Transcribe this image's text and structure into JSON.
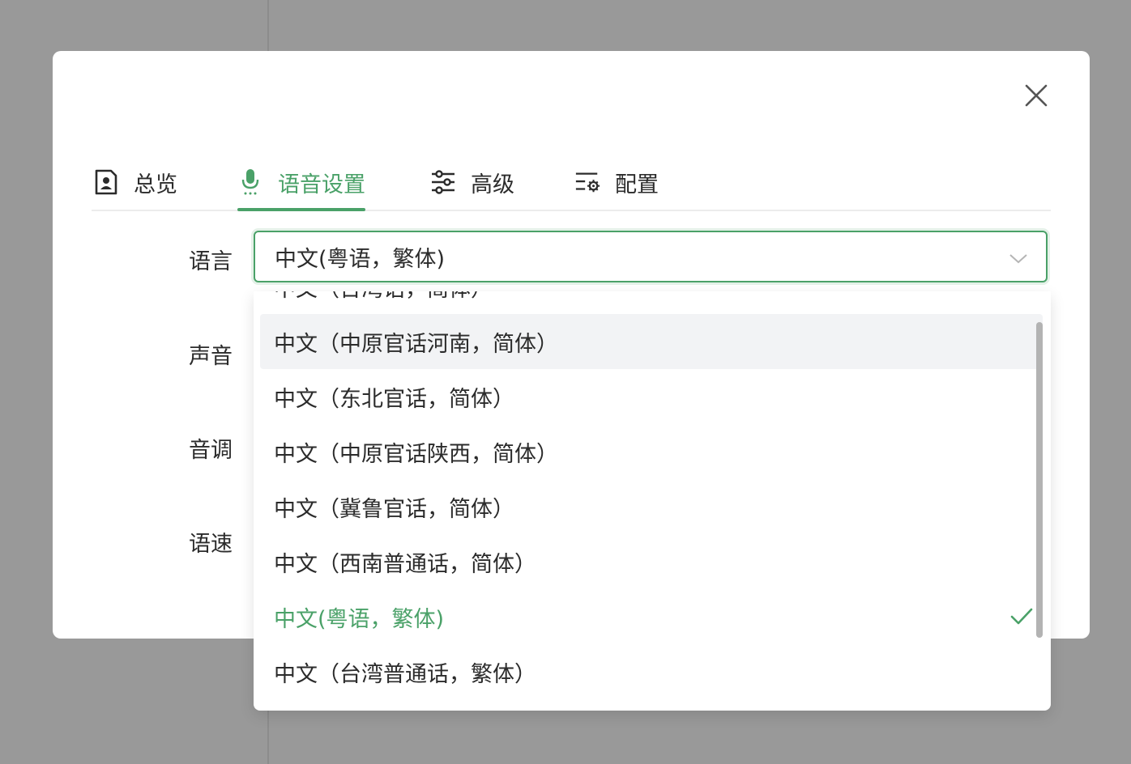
{
  "dialog": {
    "close_icon": "close-icon",
    "tabs": [
      {
        "label": "总览",
        "icon": "document-icon",
        "active": false
      },
      {
        "label": "语音设置",
        "icon": "microphone-icon",
        "active": true
      },
      {
        "label": "高级",
        "icon": "sliders-icon",
        "active": false
      },
      {
        "label": "配置",
        "icon": "list-gear-icon",
        "active": false
      }
    ],
    "form": {
      "language_label": "语言",
      "voice_label": "声音",
      "pitch_label": "音调",
      "speed_label": "语速",
      "language_value": "中文(粤语，繁体)"
    }
  },
  "dropdown": {
    "options": [
      "中文（台湾话，简体）",
      "中文（中原官话河南，简体）",
      "中文（东北官话，简体）",
      "中文（中原官话陕西，简体）",
      "中文（冀鲁官话，简体）",
      "中文（西南普通话，简体）",
      "中文(粤语，繁体)",
      "中文（台湾普通话，繁体）"
    ],
    "hovered_index": 1,
    "selected_index": 6
  },
  "colors": {
    "accent": "#4aa168",
    "overlay": "#999999",
    "text": "#2b2b2b"
  }
}
